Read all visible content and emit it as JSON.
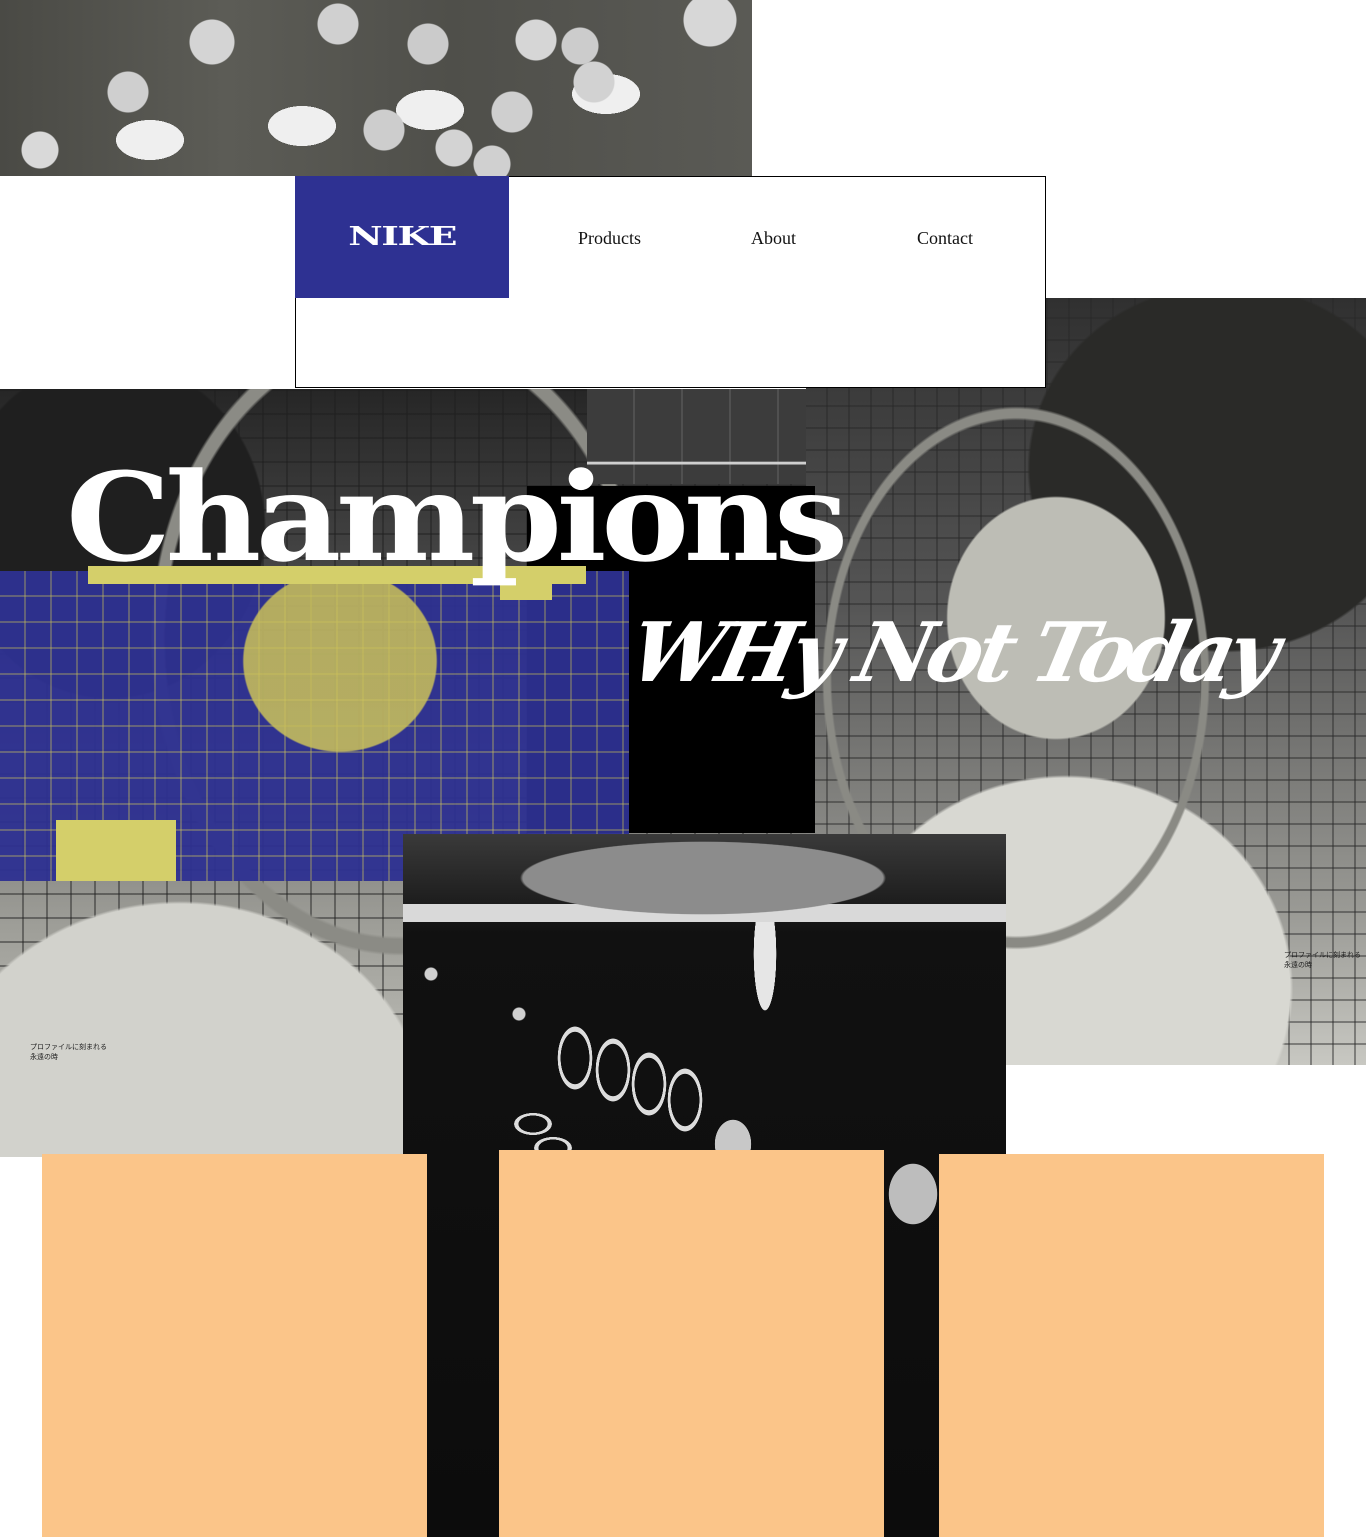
{
  "brand": {
    "logo_text": "NIKE",
    "primary_color": "#2e3192",
    "accent_yellow": "#d4cf6a",
    "card_color": "#fbc589"
  },
  "nav": {
    "items": [
      {
        "label": "Products"
      },
      {
        "label": "About"
      },
      {
        "label": "Contact"
      }
    ]
  },
  "hero": {
    "headline": "Champions",
    "subline": "WHy Not Today"
  },
  "captions": {
    "left": "プロファイルに刻まれる永遠の時",
    "right": "プロファイルに刻まれる永遠の時"
  },
  "cards": [
    {
      "name": "card-1"
    },
    {
      "name": "card-2"
    },
    {
      "name": "card-3"
    }
  ]
}
